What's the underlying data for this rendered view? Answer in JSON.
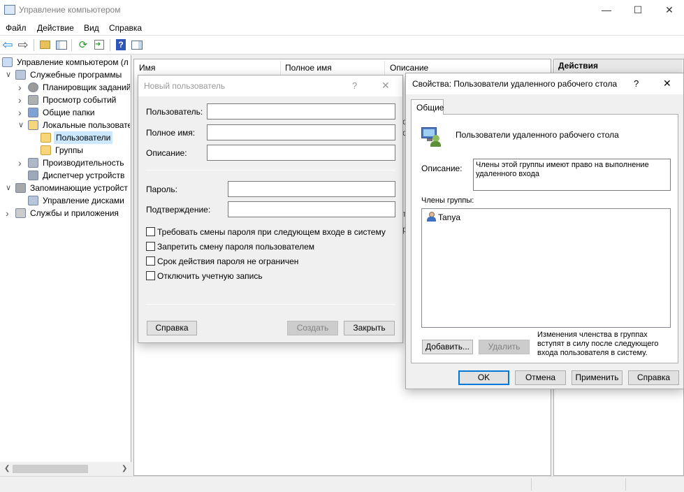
{
  "window": {
    "title": "Управление компьютером"
  },
  "menu": [
    "Файл",
    "Действие",
    "Вид",
    "Справка"
  ],
  "tree": [
    {
      "label": "Управление компьютером (л",
      "level": 0,
      "arrow": ""
    },
    {
      "label": "Служебные программы",
      "level": 1,
      "arrow": "v"
    },
    {
      "label": "Планировщик заданий",
      "level": 2,
      "arrow": ">"
    },
    {
      "label": "Просмотр событий",
      "level": 2,
      "arrow": ">"
    },
    {
      "label": "Общие папки",
      "level": 2,
      "arrow": ">"
    },
    {
      "label": "Локальные пользовате",
      "level": 2,
      "arrow": "v"
    },
    {
      "label": "Пользователи",
      "level": 3,
      "arrow": ""
    },
    {
      "label": "Группы",
      "level": 3,
      "arrow": ""
    },
    {
      "label": "Производительность",
      "level": 2,
      "arrow": ">"
    },
    {
      "label": "Диспетчер устройств",
      "level": 2,
      "arrow": ""
    },
    {
      "label": "Запоминающие устройст",
      "level": 1,
      "arrow": "v"
    },
    {
      "label": "Управление дисками",
      "level": 2,
      "arrow": ""
    },
    {
      "label": "Службы и приложения",
      "level": 1,
      "arrow": ">"
    }
  ],
  "list": {
    "columns": [
      "Имя",
      "Полное имя",
      "Описание"
    ]
  },
  "actions": {
    "header": "Действия"
  },
  "new_user": {
    "title": "Новый пользователь",
    "help": "?",
    "close": "✕",
    "user_label": "Пользователь:",
    "fullname_label": "Полное имя:",
    "desc_label": "Описание:",
    "password_label": "Пароль:",
    "confirm_label": "Подтверждение:",
    "user_value": "",
    "fullname_value": "",
    "desc_value": "",
    "password_value": "",
    "confirm_value": "",
    "checkboxes": [
      "Требовать смены пароля при следующем входе в систему",
      "Запретить смену пароля пользователем",
      "Срок действия пароля не ограничен",
      "Отключить учетную запись"
    ],
    "help_btn": "Справка",
    "create_btn": "Создать",
    "close_btn": "Закрыть"
  },
  "props": {
    "title": "Свойства: Пользователи удаленного рабочего стола",
    "help": "?",
    "close": "✕",
    "tab": "Общие",
    "group_name": "Пользователи удаленного рабочего стола",
    "desc_label": "Описание:",
    "desc_value": "Члены этой группы имеют право на выполнение удаленного входа",
    "members_label": "Члены группы:",
    "members": [
      "Tanya"
    ],
    "add_btn": "Добавить...",
    "remove_btn": "Удалить",
    "note": "Изменения членства в группах вступят в силу после следующего входа пользователя в систему.",
    "ok_btn": "OK",
    "cancel_btn": "Отмена",
    "apply_btn": "Применить",
    "help_btn": "Справка"
  },
  "colors": {
    "accent": "#0078d7",
    "selection": "#cce8ff",
    "folder": "#f7d57a"
  }
}
